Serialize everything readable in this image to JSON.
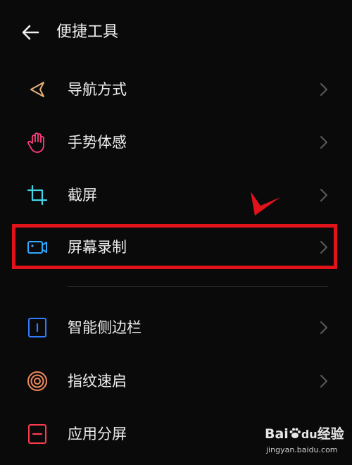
{
  "header": {
    "title": "便捷工具",
    "back_icon": "arrow-left-icon"
  },
  "menu": {
    "items": [
      {
        "label": "导航方式",
        "icon": "navigation-triangle-icon",
        "icon_color": "#e8b27a"
      },
      {
        "label": "手势体感",
        "icon": "hand-gesture-icon",
        "icon_color": "#ff3d7f"
      },
      {
        "label": "截屏",
        "icon": "crop-screenshot-icon",
        "icon_color": "#46d3e6"
      },
      {
        "label": "屏幕录制",
        "icon": "video-camera-icon",
        "icon_color": "#2fa8ff"
      },
      {
        "label": "智能侧边栏",
        "icon": "smart-sidebar-icon",
        "icon_color": "#2f7dff"
      },
      {
        "label": "指纹速启",
        "icon": "fingerprint-icon",
        "icon_color": "#f08a5d"
      },
      {
        "label": "应用分屏",
        "icon": "split-screen-icon",
        "icon_color": "#ff3b4e"
      }
    ]
  },
  "annotation": {
    "highlight_color": "#e0131b"
  },
  "watermark": {
    "brand": "Bai",
    "brand_suffix": "du",
    "brand_cn": "经验",
    "url": "jingyan.baidu.com"
  }
}
